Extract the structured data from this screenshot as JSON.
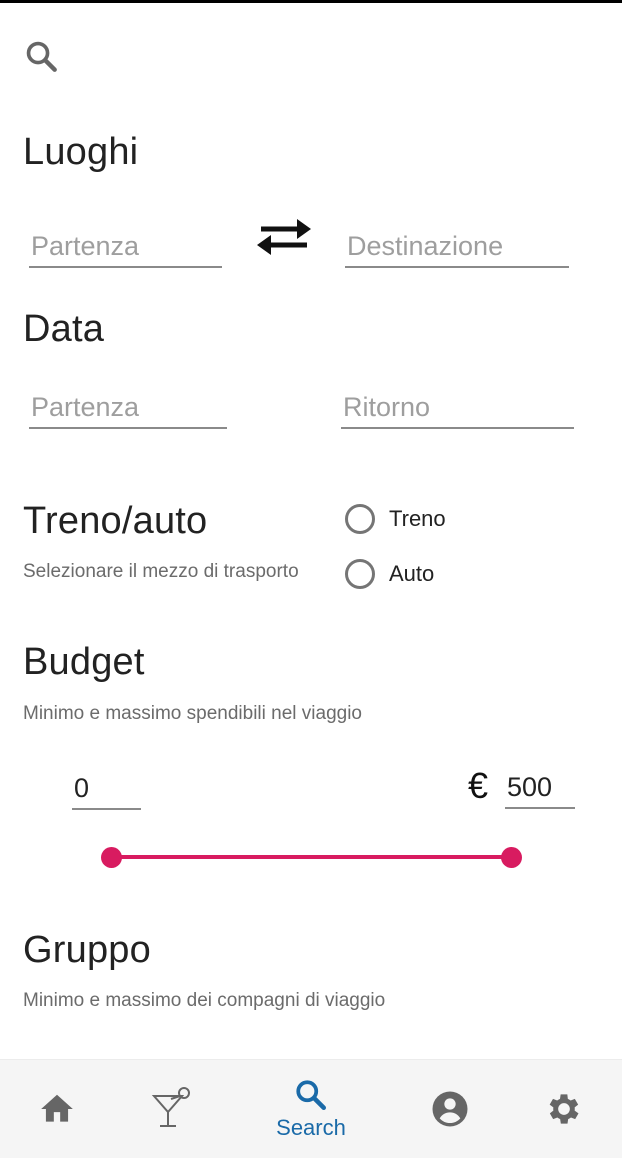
{
  "search_icon": "search-icon",
  "luoghi": {
    "title": "Luoghi",
    "from_placeholder": "Partenza",
    "to_placeholder": "Destinazione"
  },
  "data": {
    "title": "Data",
    "departure_placeholder": "Partenza",
    "return_placeholder": "Ritorno"
  },
  "transport": {
    "title": "Treno/auto",
    "subtitle": "Selezionare il mezzo di trasporto",
    "options": [
      "Treno",
      "Auto"
    ]
  },
  "budget": {
    "title": "Budget",
    "subtitle": "Minimo e massimo spendibili nel viaggio",
    "min_value": "0",
    "currency": "€",
    "max_value": "500",
    "range_fraction": [
      0,
      1
    ]
  },
  "gruppo": {
    "title": "Gruppo",
    "subtitle": "Minimo e massimo dei compagni di viaggio"
  },
  "nav": {
    "items": [
      "home-icon",
      "cocktail-icon",
      "search-icon",
      "account-icon",
      "settings-icon"
    ],
    "active_label": "Search"
  },
  "colors": {
    "accent": "#d81b60",
    "nav_active": "#1a6aa8",
    "nav_icon": "#666666"
  }
}
